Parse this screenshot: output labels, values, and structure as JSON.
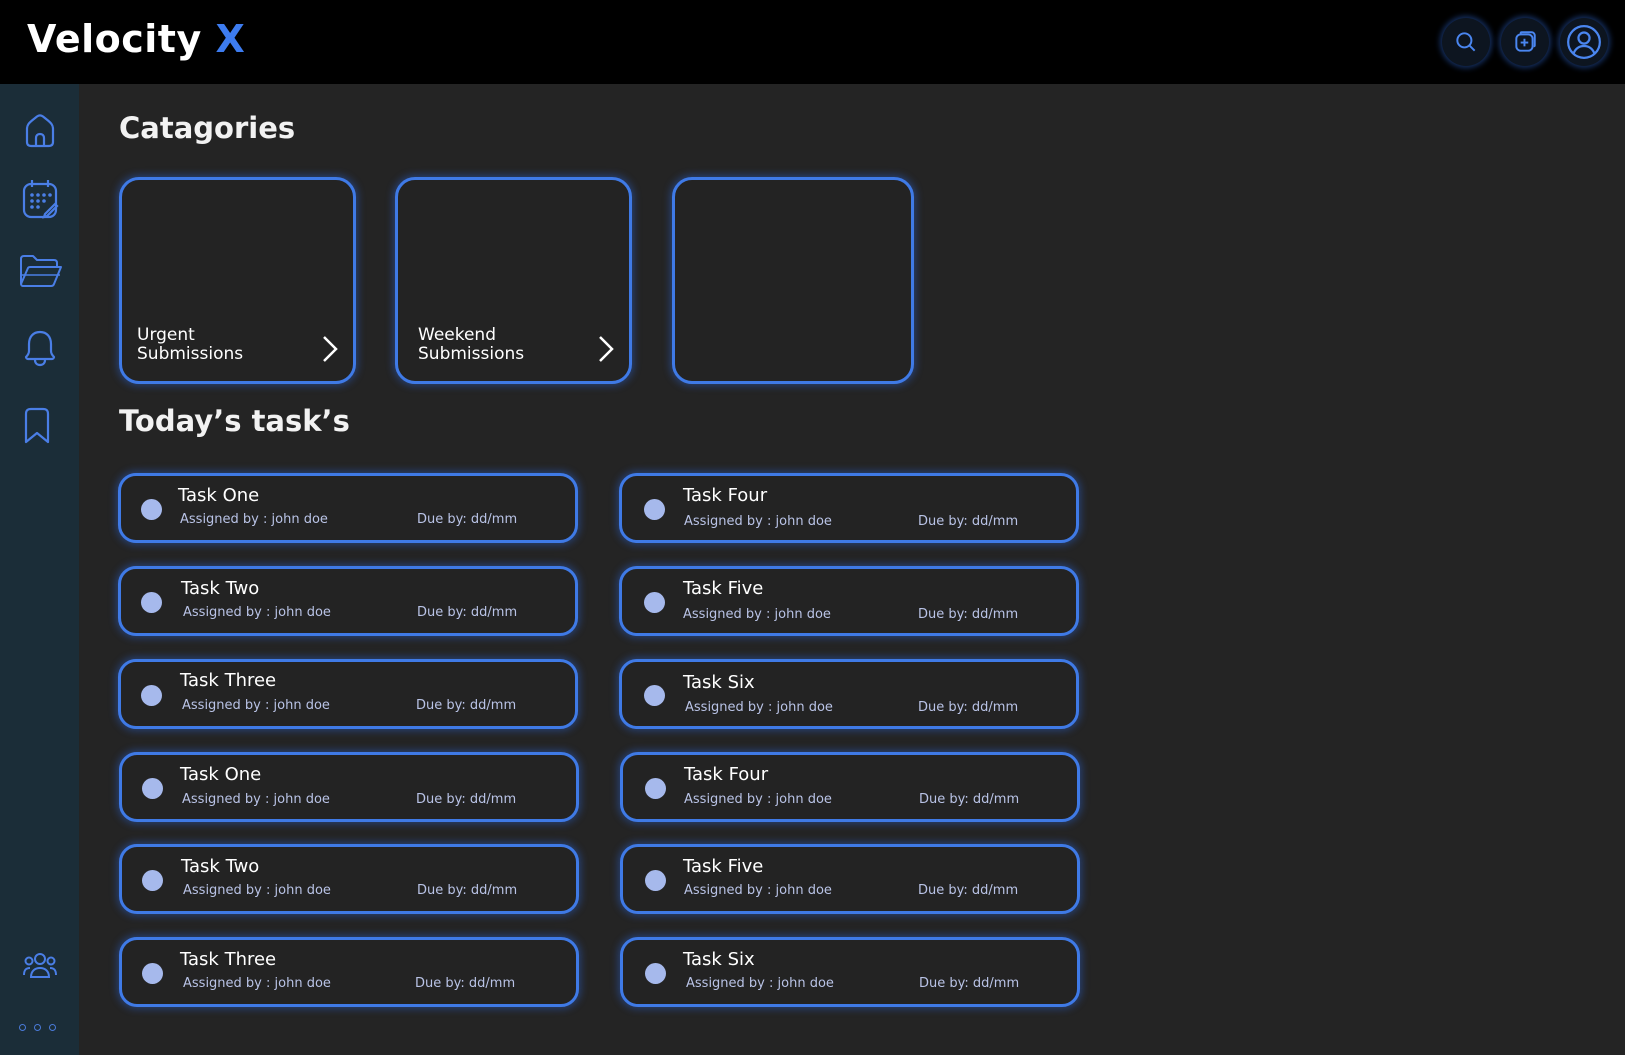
{
  "header": {
    "brand_name": "Velocity",
    "brand_accent": "X",
    "icons": [
      "search-icon",
      "add-icon",
      "profile-icon"
    ]
  },
  "colors": {
    "accent": "#3d7cf0",
    "background": "#242424",
    "sidebar": "#1b2d38",
    "topbar": "#000000",
    "task_check": "#a6b9ec"
  },
  "sidebar": {
    "icons": [
      "home-icon",
      "calendar-icon",
      "folder-icon",
      "bell-icon",
      "bookmark-icon",
      "team-icon"
    ]
  },
  "categories": {
    "title": "Catagories",
    "items": [
      {
        "label": "Urgent Submissions",
        "icon": "chevron-right-icon"
      },
      {
        "label": "Weekend Submissions",
        "icon": "chevron-right-icon"
      },
      {
        "label": ""
      }
    ]
  },
  "tasks": {
    "title": "Today’s task’s",
    "items": [
      {
        "title": "Task One",
        "assigned": "Assigned by : john doe",
        "due": "Due by: dd/mm"
      },
      {
        "title": "Task Four",
        "assigned": "Assigned by : john doe",
        "due": "Due by: dd/mm"
      },
      {
        "title": "Task Two",
        "assigned": "Assigned by : john doe",
        "due": "Due by: dd/mm"
      },
      {
        "title": "Task Five",
        "assigned": "Assigned by : john doe",
        "due": "Due by: dd/mm"
      },
      {
        "title": "Task Three",
        "assigned": "Assigned by : john doe",
        "due": "Due by: dd/mm"
      },
      {
        "title": "Task Six",
        "assigned": "Assigned by : john doe",
        "due": "Due by: dd/mm"
      },
      {
        "title": "Task One",
        "assigned": "Assigned by : john doe",
        "due": "Due by: dd/mm"
      },
      {
        "title": "Task Four",
        "assigned": "Assigned by : john doe",
        "due": "Due by: dd/mm"
      },
      {
        "title": "Task Two",
        "assigned": "Assigned by : john doe",
        "due": "Due by: dd/mm"
      },
      {
        "title": "Task Five",
        "assigned": "Assigned by : john doe",
        "due": "Due by: dd/mm"
      },
      {
        "title": "Task Three",
        "assigned": "Assigned by : john doe",
        "due": "Due by: dd/mm"
      },
      {
        "title": "Task Six",
        "assigned": "Assigned by : john doe",
        "due": "Due by: dd/mm"
      }
    ]
  }
}
